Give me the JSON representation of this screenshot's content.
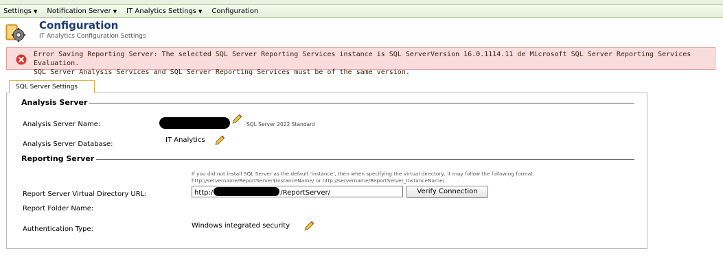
{
  "menu": {
    "items": [
      {
        "label": "Settings",
        "has_arrow": true
      },
      {
        "label": "Notification Server",
        "has_arrow": true
      },
      {
        "label": "IT Analytics Settings",
        "has_arrow": true
      },
      {
        "label": "Configuration",
        "has_arrow": false
      }
    ],
    "arrow": "▼"
  },
  "header": {
    "icon": "configuration-gear-icon",
    "title": "Configuration",
    "subtitle": "IT Analytics Configuration Settings"
  },
  "error": {
    "icon": "error-x-icon",
    "line1": "Error Saving Reporting Server: The selected SQL Server Reporting Services instance is SQL ServerVersion 16.0.1114.11 de Microsoft SQL Server Reporting Services Evaluation.",
    "line2": "SQL Server Analysis Services and SQL Server Reporting Services must be of the same version."
  },
  "tabs": [
    {
      "label": "SQL Server Settings",
      "active": true
    }
  ],
  "analysis": {
    "heading": "Analysis Server",
    "server_name_label": "Analysis Server Name:",
    "server_name_value": "[redacted]",
    "server_edition": "SQL Server 2022 Standard",
    "database_label": "Analysis Server Database:",
    "database_value": "IT Analytics"
  },
  "reporting": {
    "heading": "Reporting Server",
    "hint_line1": "If you did not install SQL Server as the default 'instance', then when specifying the virtual directory, it may follow the following format:",
    "hint_line2": "http://servername/ReportServer$InstanceName/ or http://servername/ReportServer_InstanceName/",
    "url_label": "Report Server Virtual Directory URL:",
    "url_prefix": "http:/",
    "url_suffix": "/ReportServer/",
    "verify_label": "Verify Connection",
    "folder_label": "Report Folder Name:",
    "auth_label": "Authentication Type:",
    "auth_value": "Windows integrated security"
  },
  "colors": {
    "title": "#1d3b73",
    "error_bg": "#f9dddd",
    "error_icon": "#d9342b",
    "tab_border": "#e7b548",
    "menubar": "#e4efd8"
  }
}
